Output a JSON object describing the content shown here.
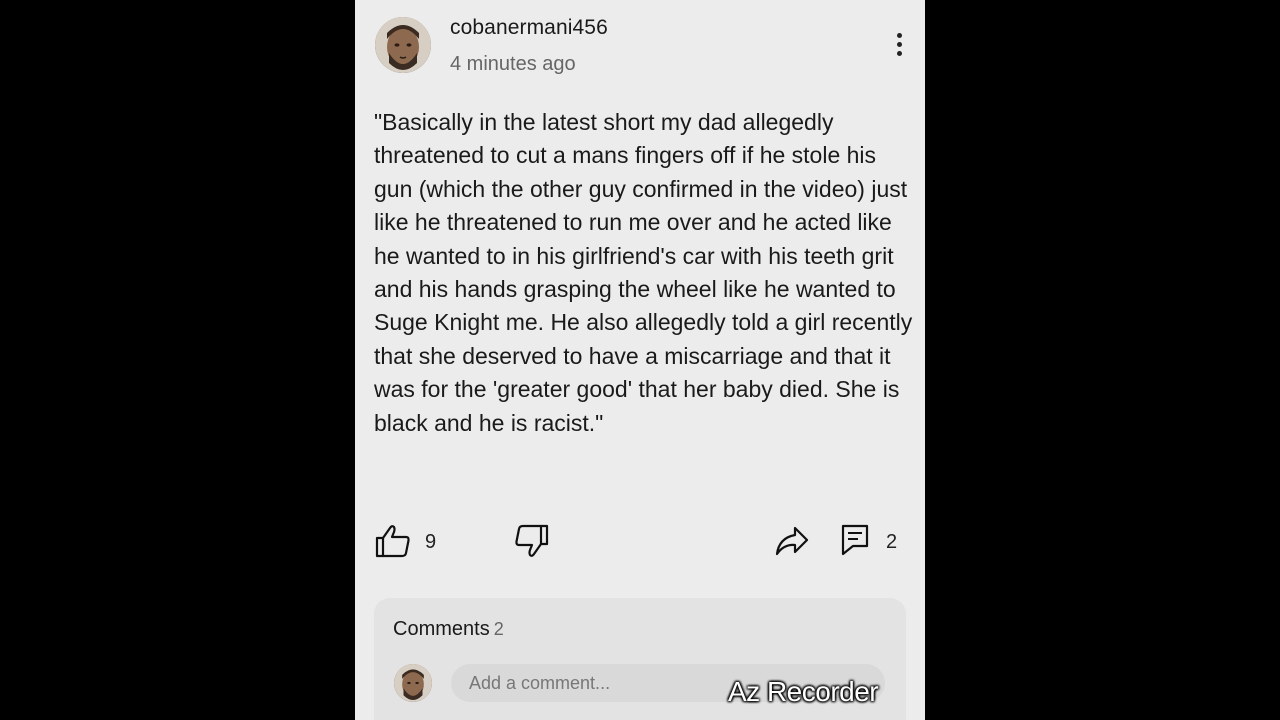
{
  "comment": {
    "username": "cobanermani456",
    "timestamp": "4 minutes ago",
    "text": "\"Basically in the latest short my dad allegedly threatened to cut a mans fingers off if he stole his gun (which the other guy confirmed in the video) just like he threatened to run me over and he acted like he wanted to in his girlfriend's car with his teeth grit and his hands grasping the wheel like he wanted to Suge Knight me. He also allegedly told a girl recently that she deserved to have a miscarriage and that it was for the 'greater good' that her baby died. She is black and he is racist.\"",
    "like_count": "9",
    "reply_count": "2",
    "icons": {
      "avatar": "avatar-icon",
      "menu": "more-vert-icon",
      "like": "thumbs-up-icon",
      "dislike": "thumbs-down-icon",
      "share": "share-icon",
      "reply": "comment-icon"
    }
  },
  "comments_section": {
    "title": "Comments",
    "count": "2",
    "input_placeholder": "Add a comment..."
  },
  "overlay": {
    "watermark": "Az Recorder"
  },
  "colors": {
    "background": "#000000",
    "panel": "#ececec",
    "card": "#e3e3e3",
    "text": "#1a1a1a",
    "muted_text": "#666666"
  }
}
